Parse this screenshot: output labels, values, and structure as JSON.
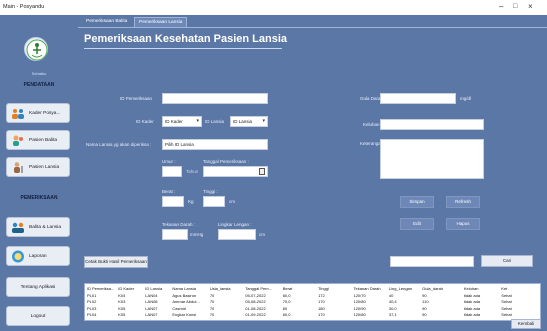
{
  "window": {
    "title": "Main - Posyandu",
    "minimize": "–",
    "maximize": "□",
    "close": "×"
  },
  "sidebar": {
    "logo_text": "Sehatku",
    "section_pendataan": "PENDATAAN",
    "section_pemeriksaan": "PEMERIKSAAN",
    "items": [
      {
        "label": "Kader Posya..."
      },
      {
        "label": "Pasien Balita"
      },
      {
        "label": "Pasien Lansia"
      },
      {
        "label": "Balita & Lansia"
      },
      {
        "label": "Laporan"
      },
      {
        "label": "Tentang Aplikasi"
      },
      {
        "label": "Logout"
      }
    ]
  },
  "tabs": [
    {
      "label": "Pemeriksaan Balita"
    },
    {
      "label": "Pemeriksaan Lansia"
    }
  ],
  "page_title": "Pemeriksaan Kesehatan Pasien Lansia",
  "form": {
    "id_pemeriksaan_label": "ID Pemeriksaan",
    "id_pemeriksaan_value": "",
    "id_kader_label": "ID Kader",
    "id_kader_value": "ID Kader",
    "id_lansia_label": "ID Lansia",
    "id_lansia_value": "ID Lansia",
    "nama_label": "Nama Lansia yg akan diperiksa :",
    "nama_value": "Pilih ID Lansia",
    "umur_label": "Umur :",
    "umur_value": "",
    "tanggal_label": "Tanggal Pemeriksaan :",
    "tanggal_value": "",
    "tahun_label": "Tahun",
    "berat_label": "Berat :",
    "berat_value": "",
    "berat_unit": "Kg",
    "tinggi_label": "Tinggi :",
    "tinggi_value": "",
    "tinggi_unit": "cm",
    "tekanan_label": "Tekanan Darah :",
    "tekanan_value": "",
    "tekanan_unit": "mmHg",
    "lingkar_label": "Lingkar Lengan :",
    "lingkar_value": "",
    "lingkar_unit": "cm",
    "gula_label": "Gula Darah :",
    "gula_value": "",
    "gula_unit": "mg/dl",
    "keluhan_label": "Keluhan :",
    "keluhan_value": "",
    "keterangan_label": "Keterangan :",
    "keterangan_value": ""
  },
  "buttons": {
    "simpan": "Simpan",
    "refresh": "Refresh",
    "edit": "Edit",
    "hapus": "Hapus",
    "cetak": "Cetak Bukti Hasil Pemeriksaan",
    "cari": "Cari",
    "kembali": "Kembali"
  },
  "search": {
    "value": ""
  },
  "table": {
    "columns": [
      "ID Pemeriksa...",
      "ID Kader",
      "ID Lansia",
      "Nama Lansia",
      "Usia_lansia",
      "Tanggal Pem...",
      "Berat",
      "Tinggi",
      "Tekanan Darah",
      "Ling_Lengan",
      "Gula_darah",
      "Keluhan",
      "Ket"
    ],
    "rows": [
      [
        "PL01",
        "K04",
        "LAN04",
        "Agus Basiron",
        "70",
        "05-07-2022",
        "60,0",
        "172",
        "120/70",
        "40",
        "90",
        "tidak ada",
        "Sehat"
      ],
      [
        "PL02",
        "K03",
        "LAN08",
        "Ammar Abdul...",
        "70",
        "05-08-2022",
        "70,0",
        "170",
        "120/80",
        "40,4",
        "110",
        "tidak ada",
        "Sehat"
      ],
      [
        "PL03",
        "K05",
        "LAN07",
        "Casmiri",
        "70",
        "01-08-2022",
        "60",
        "180",
        "120/90",
        "30,0",
        "90",
        "tidak ada",
        "Sehat"
      ],
      [
        "PL04",
        "K05",
        "LAN07",
        "Engkar Kunsi",
        "70",
        "01-09-2022",
        "60,0",
        "170",
        "120/80",
        "37,1",
        "90",
        "tidak ada",
        "Sehat"
      ]
    ]
  }
}
